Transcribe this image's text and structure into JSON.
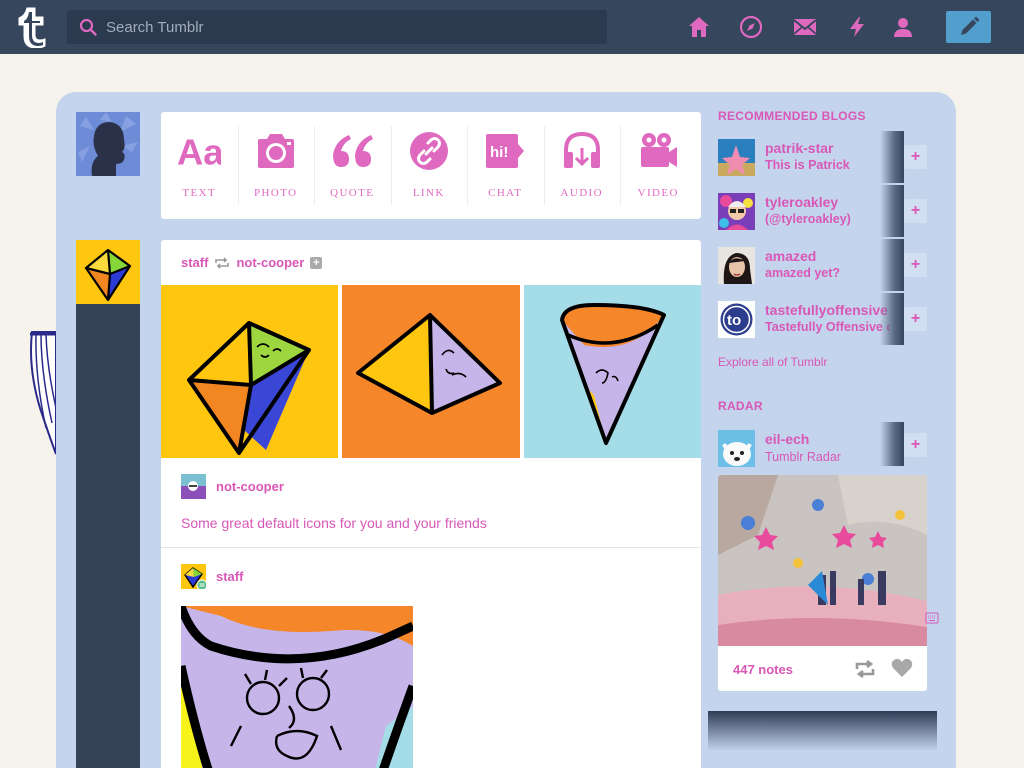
{
  "search": {
    "placeholder": "Search Tumblr"
  },
  "nav": {
    "items": [
      {
        "name": "home-icon"
      },
      {
        "name": "explore-compass-icon"
      },
      {
        "name": "inbox-mail-icon"
      },
      {
        "name": "activity-lightning-icon"
      },
      {
        "name": "account-person-icon"
      }
    ],
    "compose_icon": "pencil-icon"
  },
  "post_types": [
    {
      "label": "TEXT",
      "icon": "text-aa-icon"
    },
    {
      "label": "PHOTO",
      "icon": "camera-icon"
    },
    {
      "label": "QUOTE",
      "icon": "quote-icon"
    },
    {
      "label": "LINK",
      "icon": "link-icon"
    },
    {
      "label": "CHAT",
      "icon": "chat-bubble-icon"
    },
    {
      "label": "AUDIO",
      "icon": "headphones-icon"
    },
    {
      "label": "VIDEO",
      "icon": "video-camera-icon"
    }
  ],
  "post": {
    "author": "staff",
    "reblogged_from": "not-cooper",
    "reblog_source": "not-cooper",
    "text": "Some great default icons for you and your friends",
    "second_author": "staff"
  },
  "sidebar": {
    "recommended_title": "RECOMMENDED BLOGS",
    "blogs": [
      {
        "name": "patrik-star",
        "title": "This is Patrick"
      },
      {
        "name": "tyleroakley",
        "title": "(@tyleroakley)"
      },
      {
        "name": "amazed",
        "title": "amazed yet?"
      },
      {
        "name": "tastefullyoffensive",
        "title": "Tastefully Offensive c"
      }
    ],
    "follow_label": "+",
    "explore_link": "Explore all of Tumblr",
    "radar_title": "RADAR",
    "radar": {
      "name": "eil-ech",
      "sub": "Tumblr Radar",
      "notes": "447 notes"
    }
  },
  "colors": {
    "accent": "#d957b7",
    "topbar": "#36465d",
    "panel": "#c4d4ec",
    "compose": "#529ecc"
  }
}
